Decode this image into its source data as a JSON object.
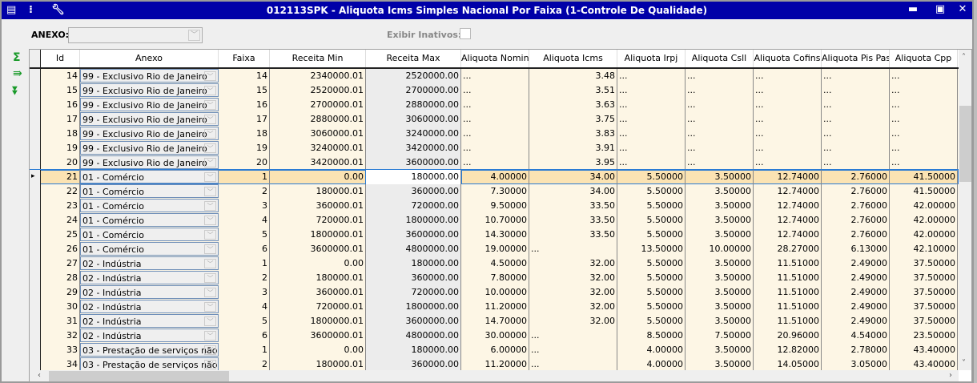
{
  "window": {
    "title": "012113SPK - Aliquota Icms Simples Nacional Por Faixa (1-Controle De Qualidade)"
  },
  "filters": {
    "anexo_label": "ANEXO:",
    "anexo_value": "",
    "inativos_label": "Exibir Inativos:",
    "inativos_checked": false
  },
  "columns": [
    "Id",
    "Anexo",
    "Faixa",
    "Receita Min",
    "Receita Max",
    "Aliquota Nominal",
    "Aliquota Icms",
    "Aliquota Irpj",
    "Aliquota Csll",
    "Aliquota Cofins",
    "Aliquota Pis Pasep",
    "Aliquota Cpp"
  ],
  "selected_row_id": "21",
  "rows": [
    [
      "14",
      "99 - Exclusivo Rio de Janeiro",
      "14",
      "2340000.01",
      "2520000.00",
      "...",
      "3.48",
      "...",
      "...",
      "...",
      "...",
      "..."
    ],
    [
      "15",
      "99 - Exclusivo Rio de Janeiro",
      "15",
      "2520000.01",
      "2700000.00",
      "...",
      "3.51",
      "...",
      "...",
      "...",
      "...",
      "..."
    ],
    [
      "16",
      "99 - Exclusivo Rio de Janeiro",
      "16",
      "2700000.01",
      "2880000.00",
      "...",
      "3.63",
      "...",
      "...",
      "...",
      "...",
      "..."
    ],
    [
      "17",
      "99 - Exclusivo Rio de Janeiro",
      "17",
      "2880000.01",
      "3060000.00",
      "...",
      "3.75",
      "...",
      "...",
      "...",
      "...",
      "..."
    ],
    [
      "18",
      "99 - Exclusivo Rio de Janeiro",
      "18",
      "3060000.01",
      "3240000.00",
      "...",
      "3.83",
      "...",
      "...",
      "...",
      "...",
      "..."
    ],
    [
      "19",
      "99 - Exclusivo Rio de Janeiro",
      "19",
      "3240000.01",
      "3420000.00",
      "...",
      "3.91",
      "...",
      "...",
      "...",
      "...",
      "..."
    ],
    [
      "20",
      "99 - Exclusivo Rio de Janeiro",
      "20",
      "3420000.01",
      "3600000.00",
      "...",
      "3.95",
      "...",
      "...",
      "...",
      "...",
      "..."
    ],
    [
      "21",
      "01 - Comércio",
      "1",
      "0.00",
      "180000.00",
      "4.00000",
      "34.00",
      "5.50000",
      "3.50000",
      "12.74000",
      "2.76000",
      "41.50000"
    ],
    [
      "22",
      "01 - Comércio",
      "2",
      "180000.01",
      "360000.00",
      "7.30000",
      "34.00",
      "5.50000",
      "3.50000",
      "12.74000",
      "2.76000",
      "41.50000"
    ],
    [
      "23",
      "01 - Comércio",
      "3",
      "360000.01",
      "720000.00",
      "9.50000",
      "33.50",
      "5.50000",
      "3.50000",
      "12.74000",
      "2.76000",
      "42.00000"
    ],
    [
      "24",
      "01 - Comércio",
      "4",
      "720000.01",
      "1800000.00",
      "10.70000",
      "33.50",
      "5.50000",
      "3.50000",
      "12.74000",
      "2.76000",
      "42.00000"
    ],
    [
      "25",
      "01 - Comércio",
      "5",
      "1800000.01",
      "3600000.00",
      "14.30000",
      "33.50",
      "5.50000",
      "3.50000",
      "12.74000",
      "2.76000",
      "42.00000"
    ],
    [
      "26",
      "01 - Comércio",
      "6",
      "3600000.01",
      "4800000.00",
      "19.00000",
      "...",
      "13.50000",
      "10.00000",
      "28.27000",
      "6.13000",
      "42.10000"
    ],
    [
      "27",
      "02 - Indústria",
      "1",
      "0.00",
      "180000.00",
      "4.50000",
      "32.00",
      "5.50000",
      "3.50000",
      "11.51000",
      "2.49000",
      "37.50000"
    ],
    [
      "28",
      "02 - Indústria",
      "2",
      "180000.01",
      "360000.00",
      "7.80000",
      "32.00",
      "5.50000",
      "3.50000",
      "11.51000",
      "2.49000",
      "37.50000"
    ],
    [
      "29",
      "02 - Indústria",
      "3",
      "360000.01",
      "720000.00",
      "10.00000",
      "32.00",
      "5.50000",
      "3.50000",
      "11.51000",
      "2.49000",
      "37.50000"
    ],
    [
      "30",
      "02 - Indústria",
      "4",
      "720000.01",
      "1800000.00",
      "11.20000",
      "32.00",
      "5.50000",
      "3.50000",
      "11.51000",
      "2.49000",
      "37.50000"
    ],
    [
      "31",
      "02 - Indústria",
      "5",
      "1800000.01",
      "3600000.00",
      "14.70000",
      "32.00",
      "5.50000",
      "3.50000",
      "11.51000",
      "2.49000",
      "37.50000"
    ],
    [
      "32",
      "02 - Indústria",
      "6",
      "3600000.01",
      "4800000.00",
      "30.00000",
      "...",
      "8.50000",
      "7.50000",
      "20.96000",
      "4.54000",
      "23.50000"
    ],
    [
      "33",
      "03 - Prestação de serviços não",
      "1",
      "0.00",
      "180000.00",
      "6.00000",
      "...",
      "4.00000",
      "3.50000",
      "12.82000",
      "2.78000",
      "43.40000"
    ],
    [
      "34",
      "03 - Prestação de serviços não",
      "2",
      "180000.01",
      "360000.00",
      "11.20000",
      "...",
      "4.00000",
      "3.50000",
      "14.05000",
      "3.05000",
      "43.40000"
    ]
  ]
}
